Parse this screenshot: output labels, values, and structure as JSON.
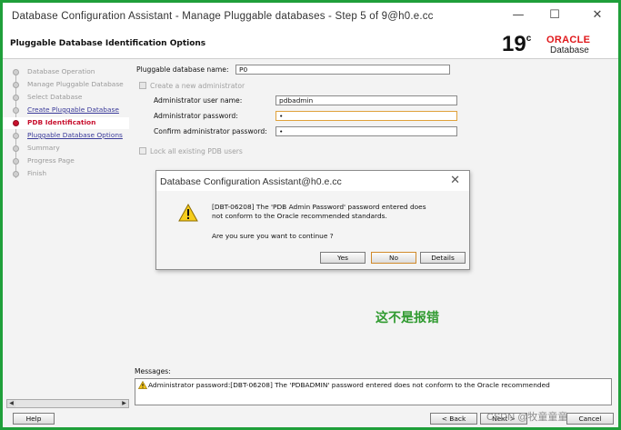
{
  "window": {
    "title": "Database Configuration Assistant - Manage Pluggable databases - Step 5 of 9@h0.e.cc",
    "minimize_glyph": "—",
    "maximize_glyph": "☐",
    "close_glyph": "✕"
  },
  "header": {
    "page_title": "Pluggable Database Identification Options",
    "logo_version": "19",
    "logo_sup": "c",
    "logo_brand": "ORACLE",
    "logo_sub": "Database"
  },
  "nav": {
    "items": [
      {
        "label": "Database Operation",
        "state": "done"
      },
      {
        "label": "Manage Pluggable Database",
        "state": "done"
      },
      {
        "label": "Select Database",
        "state": "done"
      },
      {
        "label": "Create Pluggable Database",
        "state": "link"
      },
      {
        "label": "PDB Identification",
        "state": "current"
      },
      {
        "label": "Pluggable Database Options",
        "state": "link"
      },
      {
        "label": "Summary",
        "state": "pending"
      },
      {
        "label": "Progress Page",
        "state": "pending"
      },
      {
        "label": "Finish",
        "state": "pending"
      }
    ],
    "scroll_left": "◀",
    "scroll_right": "▶"
  },
  "form": {
    "pdb_name_label": "Pluggable database name:",
    "pdb_name_value": "P0",
    "create_admin_label": "Create a new administrator",
    "admin_user_label": "Administrator user name:",
    "admin_user_value": "pdbadmin",
    "admin_pwd_label": "Administrator password:",
    "admin_pwd_value": "•",
    "confirm_pwd_label": "Confirm administrator password:",
    "confirm_pwd_value": "•",
    "lock_label": "Lock all existing PDB users"
  },
  "dialog": {
    "title": "Database Configuration Assistant@h0.e.cc",
    "close_glyph": "✕",
    "line1": "[DBT-06208] The 'PDB Admin Password' password entered does",
    "line2": "not conform to the Oracle recommended standards.",
    "line3": "Are you sure you want to continue ?",
    "yes_label": "Yes",
    "no_label": "No",
    "details_label": "Details"
  },
  "messages": {
    "label": "Messages:",
    "text": "Administrator password:[DBT-06208] The 'PDBADMIN' password entered does not conform to the Oracle recommended"
  },
  "buttons": {
    "help": "Help",
    "back": "< Back",
    "next": "Next >",
    "cancel": "Cancel"
  },
  "annotation": "这不是报错",
  "watermark": "CSDN @牧童童童"
}
